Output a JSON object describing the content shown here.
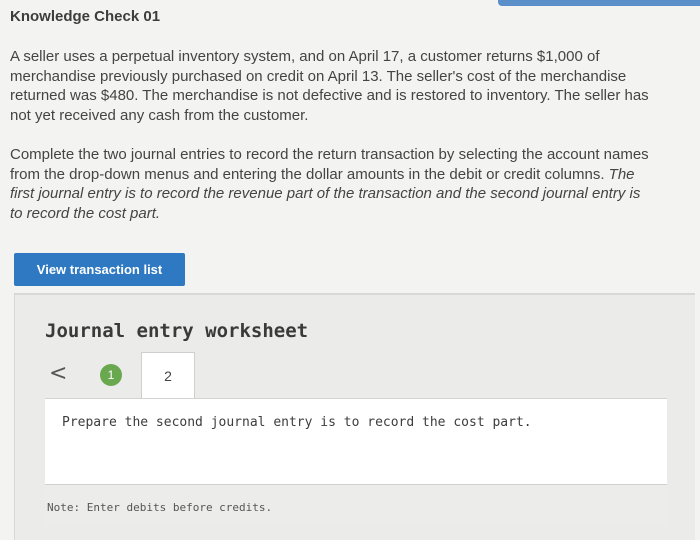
{
  "header": {
    "title": "Knowledge Check 01"
  },
  "problem": {
    "paragraph1": "A seller uses a perpetual inventory system, and on April 17, a customer returns $1,000 of merchandise previously purchased on credit on April 13. The seller's cost of the merchandise returned was $480. The merchandise is not defective and is restored to inventory. The seller has not yet received any cash from the customer.",
    "paragraph2_plain": "Complete the two journal entries to record the return transaction by selecting the account names from the drop-down menus and entering the dollar amounts in the debit or credit columns.",
    "paragraph2_italic": "The first journal entry is to record the revenue part of the transaction and the second journal entry is to record the cost part."
  },
  "buttons": {
    "view_transaction_list": "View transaction list"
  },
  "worksheet": {
    "title": "Journal entry worksheet",
    "prev_glyph": "<",
    "steps": [
      "1",
      "2"
    ],
    "active_step": 2,
    "instruction": "Prepare the second journal entry is to record the cost part.",
    "note": "Note: Enter debits before credits."
  },
  "colors": {
    "button": "#2f79c2",
    "completed_step": "#6aa84f",
    "accent": "#5a8fc9"
  }
}
